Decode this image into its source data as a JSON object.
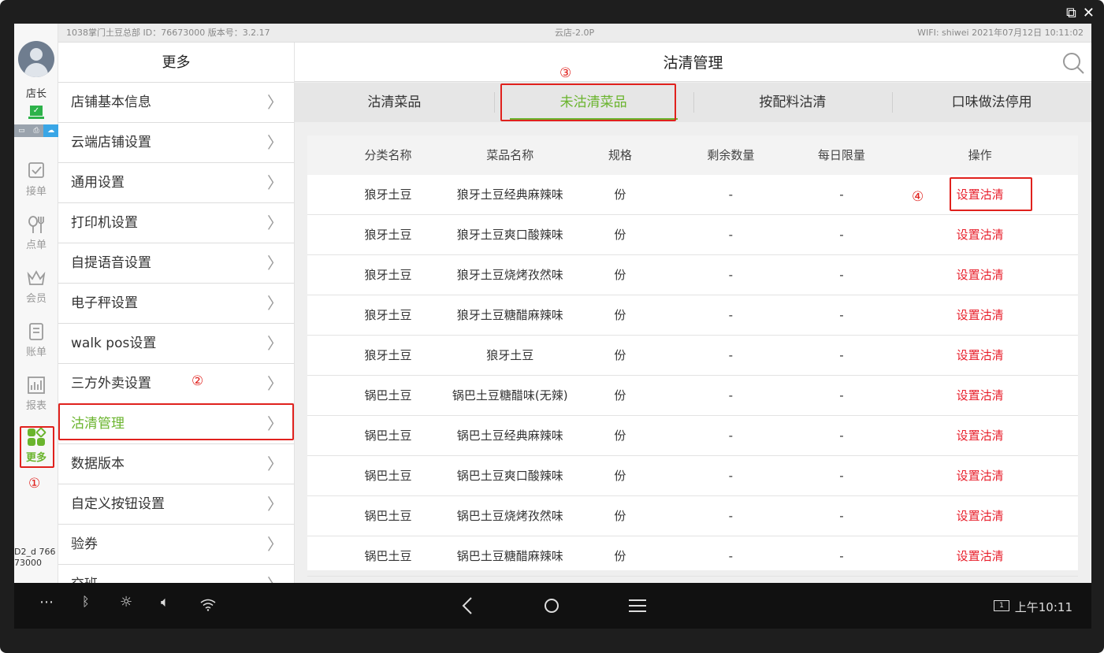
{
  "window": {
    "external_icon": "external-link-icon",
    "close_icon": "close-icon"
  },
  "status_bar": {
    "store_info": "1038掌门土豆总部 ID：76673000   版本号：3.2.17",
    "app_name": "云店-2.0P",
    "wifi_time": "WIFI: shiwei   2021年07月12日 10:11:02"
  },
  "rail": {
    "role": "店长",
    "items": [
      {
        "label": "接单",
        "icon": "order-receive-icon"
      },
      {
        "label": "点单",
        "icon": "cutlery-icon"
      },
      {
        "label": "会员",
        "icon": "crown-icon"
      },
      {
        "label": "账单",
        "icon": "bill-icon"
      },
      {
        "label": "报表",
        "icon": "report-chart-icon"
      },
      {
        "label": "更多",
        "icon": "grid-more-icon"
      }
    ],
    "footer": "D2_d 76673000"
  },
  "submenu": {
    "title": "更多",
    "items": [
      "店铺基本信息",
      "云端店铺设置",
      "通用设置",
      "打印机设置",
      "自提语音设置",
      "电子秤设置",
      "walk pos设置",
      "三方外卖设置",
      "沽清管理",
      "数据版本",
      "自定义按钮设置",
      "验券",
      "交班"
    ],
    "active_index": 8
  },
  "main": {
    "title": "沽清管理",
    "tabs": [
      "沽清菜品",
      "未沽清菜品",
      "按配料沽清",
      "口味做法停用"
    ],
    "active_tab": 1,
    "columns": [
      "分类名称",
      "菜品名称",
      "规格",
      "剩余数量",
      "每日限量",
      "操作"
    ],
    "rows": [
      {
        "cat": "狼牙土豆",
        "name": "狼牙土豆经典麻辣味",
        "spec": "份",
        "rem": "-",
        "lim": "-",
        "op": "设置沽清"
      },
      {
        "cat": "狼牙土豆",
        "name": "狼牙土豆爽口酸辣味",
        "spec": "份",
        "rem": "-",
        "lim": "-",
        "op": "设置沽清"
      },
      {
        "cat": "狼牙土豆",
        "name": "狼牙土豆烧烤孜然味",
        "spec": "份",
        "rem": "-",
        "lim": "-",
        "op": "设置沽清"
      },
      {
        "cat": "狼牙土豆",
        "name": "狼牙土豆糖醋麻辣味",
        "spec": "份",
        "rem": "-",
        "lim": "-",
        "op": "设置沽清"
      },
      {
        "cat": "狼牙土豆",
        "name": "狼牙土豆",
        "spec": "份",
        "rem": "-",
        "lim": "-",
        "op": "设置沽清"
      },
      {
        "cat": "锅巴土豆",
        "name": "锅巴土豆糖醋味(无辣)",
        "spec": "份",
        "rem": "-",
        "lim": "-",
        "op": "设置沽清"
      },
      {
        "cat": "锅巴土豆",
        "name": "锅巴土豆经典麻辣味",
        "spec": "份",
        "rem": "-",
        "lim": "-",
        "op": "设置沽清"
      },
      {
        "cat": "锅巴土豆",
        "name": "锅巴土豆爽口酸辣味",
        "spec": "份",
        "rem": "-",
        "lim": "-",
        "op": "设置沽清"
      },
      {
        "cat": "锅巴土豆",
        "name": "锅巴土豆烧烤孜然味",
        "spec": "份",
        "rem": "-",
        "lim": "-",
        "op": "设置沽清"
      },
      {
        "cat": "锅巴土豆",
        "name": "锅巴土豆糖醋麻辣味",
        "spec": "份",
        "rem": "-",
        "lim": "-",
        "op": "设置沽清"
      }
    ]
  },
  "annotations": [
    "①",
    "②",
    "③",
    "④"
  ],
  "navbar": {
    "icons": [
      "more-dots-icon",
      "bluetooth-icon",
      "brightness-icon",
      "volume-icon",
      "wifi-icon",
      "back-icon",
      "home-icon",
      "menu-icon",
      "screen-icon"
    ],
    "screen_label": "1",
    "time": "上午10:11"
  },
  "colors": {
    "accent_green": "#6ab42d",
    "action_red": "#e8202c",
    "annotation_red": "#e0211d"
  }
}
